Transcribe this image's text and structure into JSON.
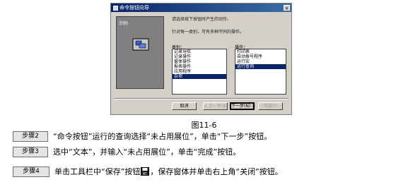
{
  "dialog": {
    "title": "命令按钮向导",
    "close_glyph": "×",
    "preview_label": "示例:",
    "instruction_1": "请选择按下按钮时产生的动作。",
    "instruction_2": "针对每一类别，可有多种不同的操作。",
    "categories_label": "类别：",
    "actions_label": "操作：",
    "categories": [
      "记录导航",
      "记录操作",
      "窗体操作",
      "报表操作",
      "应用程序",
      "杂项"
    ],
    "selected_category_index": 5,
    "actions": [
      "打印表",
      "自动拨号程序",
      "运行宏",
      "运行查询"
    ],
    "selected_action_index": 3,
    "buttons": {
      "cancel": "取消",
      "prev": "< 上一步(B)",
      "next": "下一步(N) >",
      "finish": "完成(F)"
    }
  },
  "caption": "图11-6",
  "steps": [
    {
      "badge": "步骤2",
      "text_before": "“命令按钮”运行的查询选择“未占用展位”，单击“下一步”按钮。"
    },
    {
      "badge": "步骤3",
      "text_before": "选中“文本”，并输入“未占用展位”，单击“完成”按钮。"
    },
    {
      "badge": "步骤4",
      "text_before": "单击工具栏中“保存”按钮",
      "text_after": "，保存窗体并单击右上角“关闭”按钮。"
    }
  ]
}
